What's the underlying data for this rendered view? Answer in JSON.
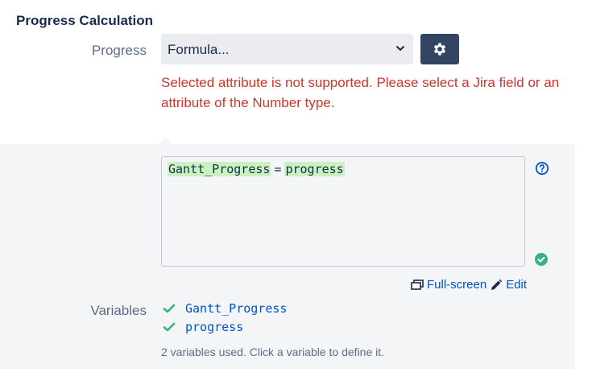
{
  "section": {
    "title": "Progress Calculation"
  },
  "progress_field": {
    "label": "Progress",
    "selected": "Formula...",
    "settings_icon": "gear-icon"
  },
  "error": {
    "message": "Selected attribute is not supported. Please select a Jira field or an attribute of the Number type."
  },
  "formula": {
    "lhs": "Gantt_Progress",
    "operator": "=",
    "rhs": "progress",
    "status_icon": "check-circle-icon"
  },
  "links": {
    "fullscreen": "Full-screen",
    "edit": "Edit"
  },
  "variables": {
    "label": "Variables",
    "items": [
      {
        "name": "Gantt_Progress",
        "defined": true
      },
      {
        "name": "progress",
        "defined": true
      }
    ],
    "hint": "2 variables used. Click a variable to define it."
  },
  "colors": {
    "error": "#c9372c",
    "link": "#0052cc",
    "success": "#36b37e",
    "token_highlight": "#c9f2c0",
    "button_dark": "#344563"
  }
}
